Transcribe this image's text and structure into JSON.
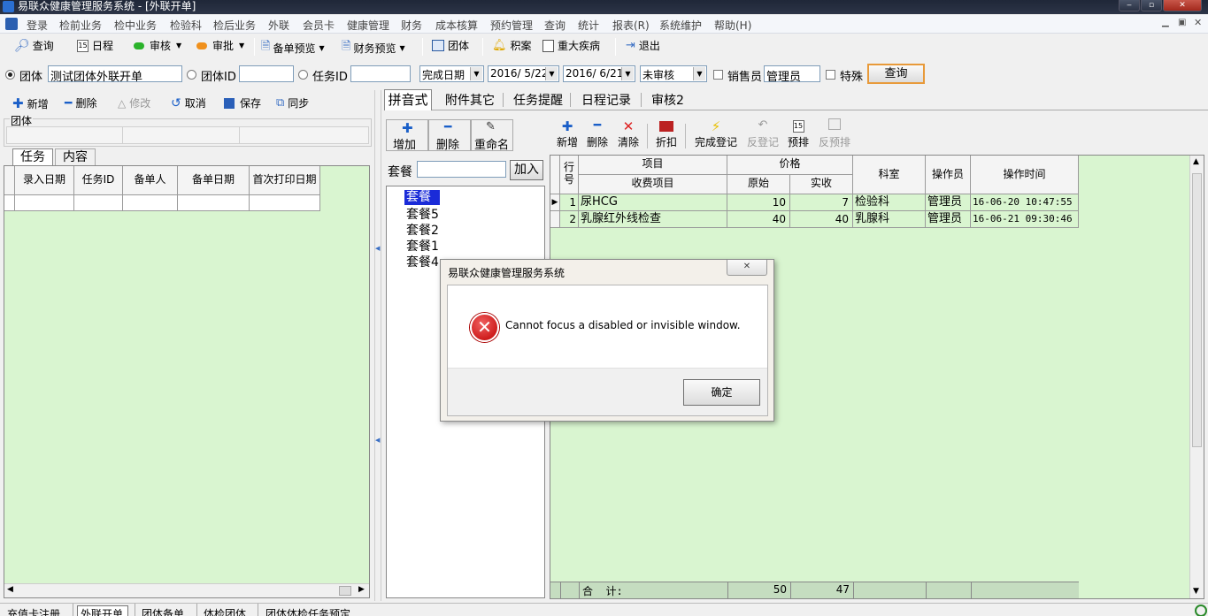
{
  "window": {
    "title": "易联众健康管理服务系统 - [外联开单]",
    "min": "‒",
    "max": "▫",
    "close": "✕"
  },
  "menu": [
    "登录",
    "检前业务",
    "检中业务",
    "检验科",
    "检后业务",
    "外联",
    "会员卡",
    "健康管理",
    "财务",
    "成本核算",
    "预约管理",
    "查询",
    "统计",
    "报表(R)",
    "系统维护",
    "帮助(H)"
  ],
  "toolbar": {
    "query": "查询",
    "schedule": "日程",
    "audit": "审核",
    "approve": "审批",
    "preview": "备单预览",
    "finance_preview": "财务预览",
    "group": "团体",
    "points": "积案",
    "disease": "重大疾病",
    "exit": "退出"
  },
  "filter": {
    "group_label": "团体",
    "group_value": "测试团体外联开单",
    "group_id_label": "团体ID",
    "group_id_value": "",
    "task_id_label": "任务ID",
    "task_id_value": "",
    "date_type": "完成日期",
    "date_from": "2016/ 5/22",
    "date_to": "2016/ 6/21",
    "status": "未审核",
    "sales_label": "销售员",
    "sales_value": "管理员",
    "special_label": "特殊",
    "query_button": "查询"
  },
  "left_actions": {
    "add": "新增",
    "delete": "删除",
    "edit": "修改",
    "cancel": "取消",
    "save": "保存",
    "sync": "同步"
  },
  "left": {
    "group_section": "团体",
    "tabs": [
      "任务",
      "内容"
    ],
    "columns": [
      "录入日期",
      "任务ID",
      "备单人",
      "备单日期",
      "首次打印日期"
    ]
  },
  "right_tabs": [
    "拼音式",
    "附件其它",
    "任务提醒",
    "日程记录",
    "审核2"
  ],
  "package_buttons": {
    "add": "增加",
    "delete": "删除",
    "rename": "重命名"
  },
  "package_label": "套餐",
  "package_input": "",
  "package_join": "加入",
  "packages": [
    "套餐",
    "套餐5",
    "套餐2",
    "套餐1",
    "套餐4"
  ],
  "item_toolbar": {
    "add": "新增",
    "delete": "删除",
    "clear": "清除",
    "discount": "折扣",
    "complete": "完成登记",
    "uncomplete": "反登记",
    "schedule": "预排",
    "unschedule": "反预排"
  },
  "items_table": {
    "headers": {
      "row": "行号",
      "item": "项目",
      "charge_item": "收费项目",
      "price": "价格",
      "original": "原始",
      "actual": "实收",
      "dept": "科室",
      "operator": "操作员",
      "time": "操作时间"
    },
    "rows": [
      {
        "no": "1",
        "item": "尿HCG",
        "original": "10",
        "actual": "7",
        "dept": "检验科",
        "operator": "管理员",
        "time": "16-06-20 10:47:55"
      },
      {
        "no": "2",
        "item": "乳腺红外线检查",
        "original": "40",
        "actual": "40",
        "dept": "乳腺科",
        "operator": "管理员",
        "time": "16-06-21 09:30:46"
      }
    ],
    "total_label": "合  计:",
    "total_original": "50",
    "total_actual": "47"
  },
  "dialog": {
    "title": "易联众健康管理服务系统",
    "message": "Cannot focus a disabled or invisible window.",
    "ok": "确定"
  },
  "bottom_tabs": [
    "充值卡注册",
    "外联开单",
    "团体备单",
    "体检团体",
    "团体体检任务预定"
  ]
}
